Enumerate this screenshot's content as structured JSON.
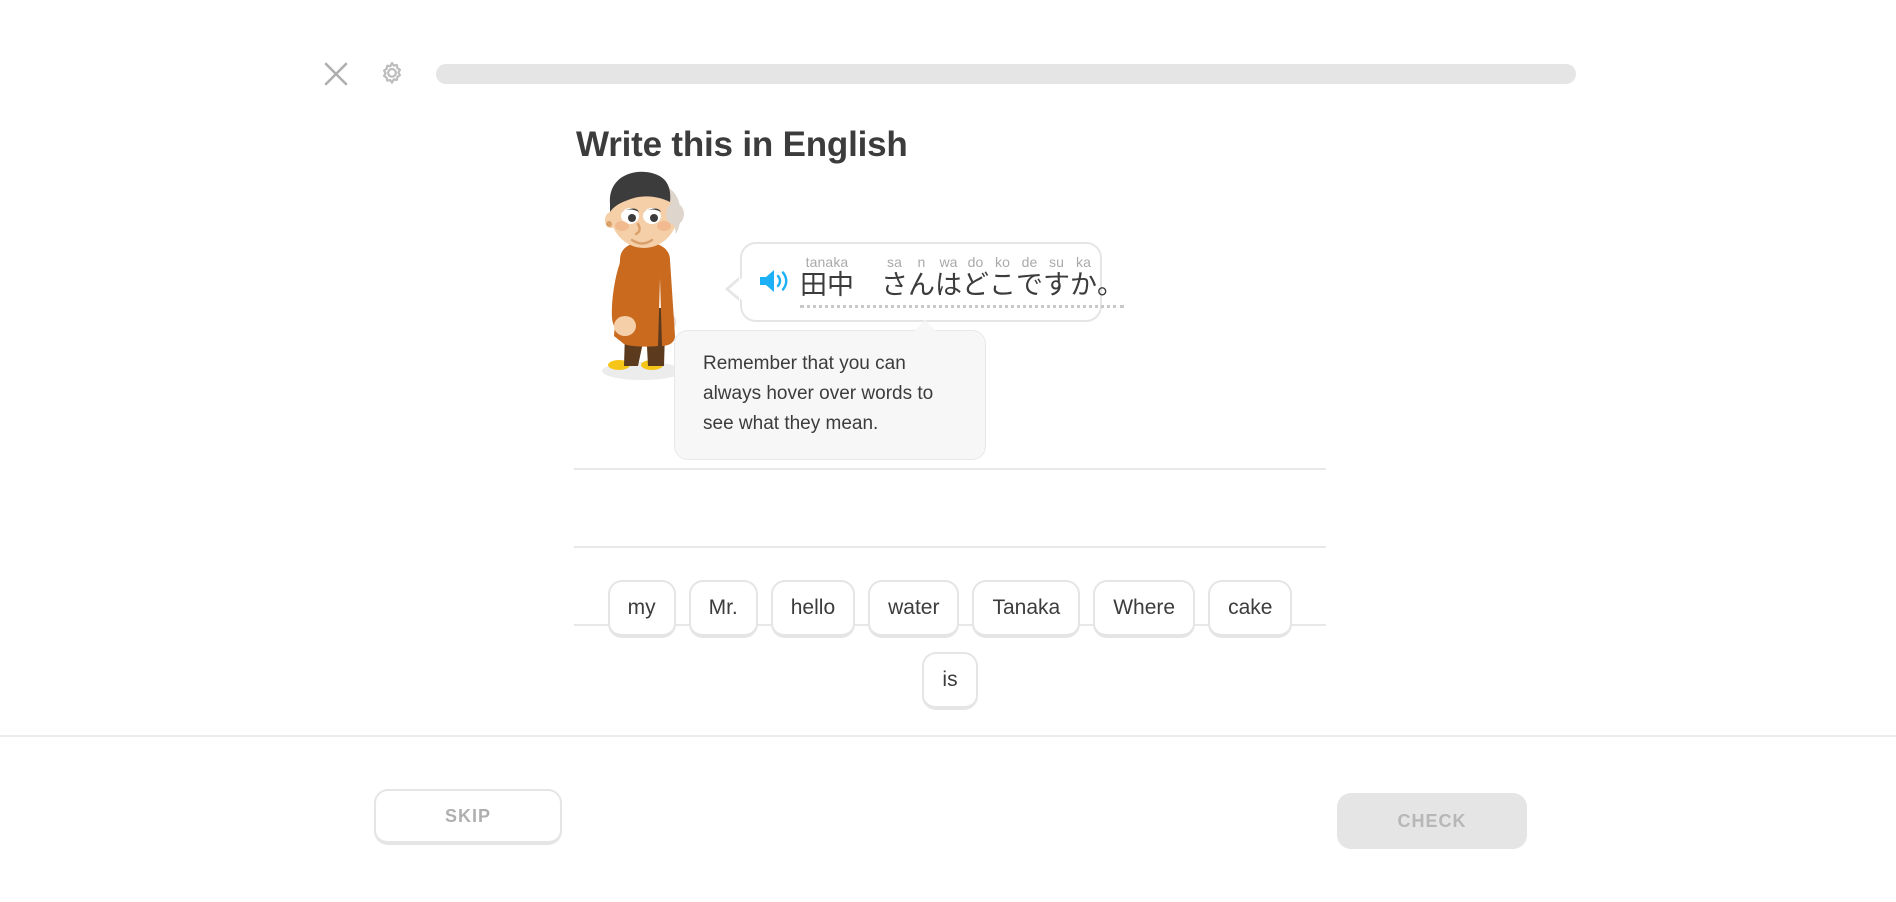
{
  "header": {
    "close_icon": "close-icon",
    "settings_icon": "gear-icon",
    "progress_percent": 0,
    "progress_track_color": "#e5e5e5",
    "progress_fill_color": "#58cc02"
  },
  "exercise": {
    "title": "Write this in English",
    "character": {
      "name": "elderly-man-character",
      "hair_color": "#3c3c3c",
      "side_hair_color": "#ded5cc",
      "skin_color": "#f5cfa8",
      "jacket_color": "#c96a1e",
      "shirt_color": "#ffffff",
      "pants_color": "#5c3a1e",
      "shoe_color": "#f5c518",
      "platform_color": "#ececed"
    },
    "prompt": {
      "speaker_icon": "speaker-icon",
      "speaker_color": "#1cb0f6",
      "tokens": [
        {
          "romaji": "tanaka",
          "kana": "田中"
        },
        {
          "romaji": "",
          "kana": "　"
        },
        {
          "romaji": "sa",
          "kana": "さ"
        },
        {
          "romaji": "n",
          "kana": "ん"
        },
        {
          "romaji": "wa",
          "kana": "は"
        },
        {
          "romaji": "do",
          "kana": "ど"
        },
        {
          "romaji": "ko",
          "kana": "こ"
        },
        {
          "romaji": "de",
          "kana": "で"
        },
        {
          "romaji": "su",
          "kana": "す"
        },
        {
          "romaji": "ka",
          "kana": "か"
        },
        {
          "romaji": "",
          "kana": "。"
        }
      ],
      "romaji_full": "tanaka sa n wa do ko de su ka",
      "sentence_full": "田中 さんはどこですか。"
    },
    "tooltip": {
      "text": "Remember that you can always hover over words to see what they mean."
    },
    "answer_lines": 3,
    "answer_values": [
      "",
      "",
      ""
    ],
    "word_bank": [
      {
        "label": "my"
      },
      {
        "label": "Mr."
      },
      {
        "label": "hello"
      },
      {
        "label": "water"
      },
      {
        "label": "Tanaka"
      },
      {
        "label": "Where"
      },
      {
        "label": "cake"
      },
      {
        "label": "is"
      }
    ]
  },
  "footer": {
    "skip_label": "SKIP",
    "check_label": "CHECK",
    "check_enabled": false
  }
}
